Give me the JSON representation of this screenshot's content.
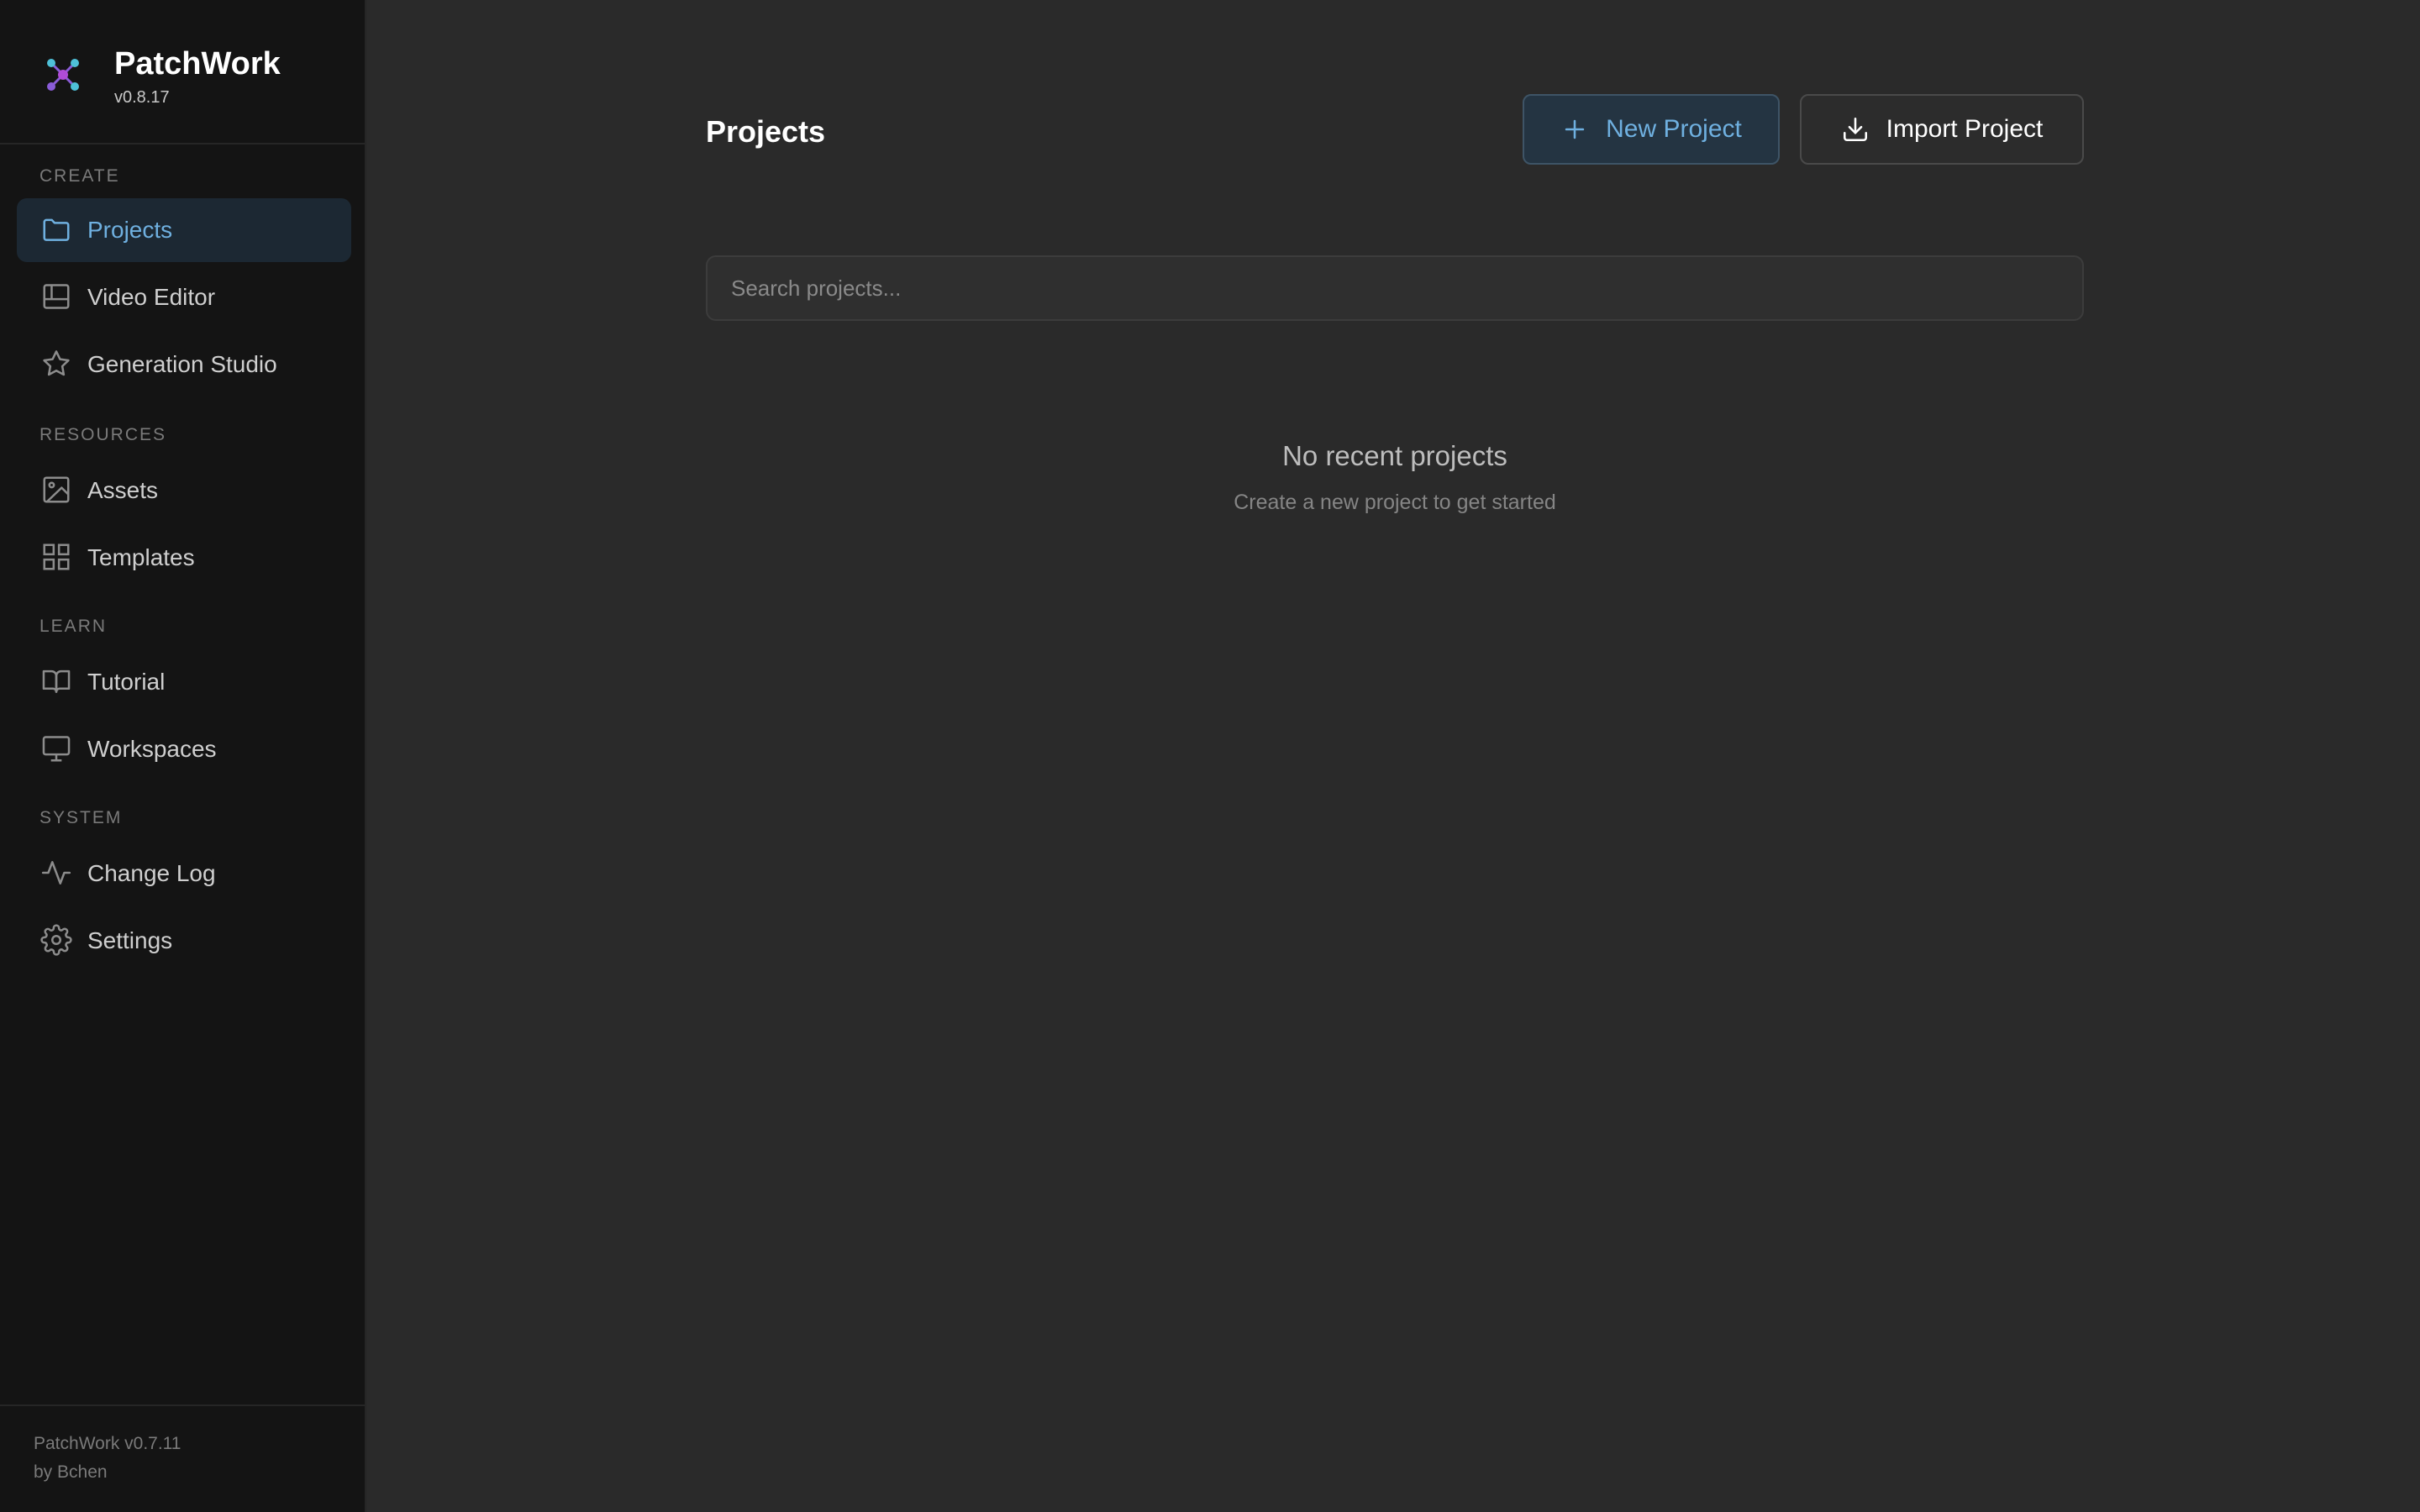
{
  "app": {
    "name": "PatchWork",
    "version": "v0.8.17"
  },
  "sidebar": {
    "sections": [
      {
        "label": "CREATE",
        "items": [
          {
            "label": "Projects",
            "icon": "folder-icon",
            "active": true
          },
          {
            "label": "Video Editor",
            "icon": "layout-icon",
            "active": false
          },
          {
            "label": "Generation Studio",
            "icon": "star-icon",
            "active": false
          }
        ]
      },
      {
        "label": "RESOURCES",
        "items": [
          {
            "label": "Assets",
            "icon": "image-icon",
            "active": false
          },
          {
            "label": "Templates",
            "icon": "grid-icon",
            "active": false
          }
        ]
      },
      {
        "label": "LEARN",
        "items": [
          {
            "label": "Tutorial",
            "icon": "book-icon",
            "active": false
          },
          {
            "label": "Workspaces",
            "icon": "monitor-icon",
            "active": false
          }
        ]
      },
      {
        "label": "SYSTEM",
        "items": [
          {
            "label": "Change Log",
            "icon": "activity-icon",
            "active": false
          },
          {
            "label": "Settings",
            "icon": "gear-icon",
            "active": false
          }
        ]
      }
    ],
    "footer": {
      "line1": "PatchWork v0.7.11",
      "line2": "by Bchen"
    }
  },
  "main": {
    "title": "Projects",
    "new_project_label": "New Project",
    "import_project_label": "Import Project",
    "search": {
      "placeholder": "Search projects...",
      "value": ""
    },
    "empty_state": {
      "title": "No recent projects",
      "subtitle": "Create a new project to get started"
    }
  },
  "colors": {
    "accent": "#6fb0e0",
    "sidebar_bg": "#141414",
    "main_bg": "#2a2a2a",
    "active_item_bg": "#1c2833"
  }
}
